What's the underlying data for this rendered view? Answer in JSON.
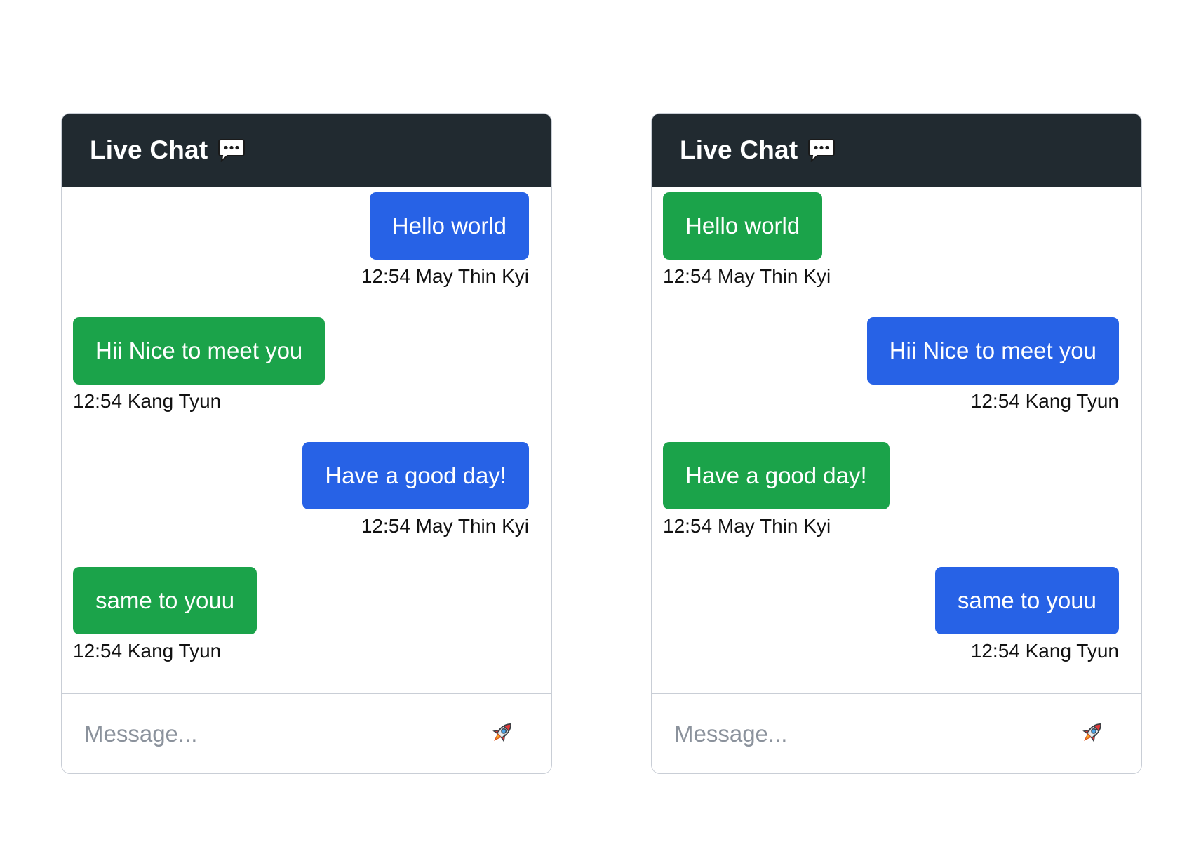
{
  "colors": {
    "header_bg": "#212a30",
    "outgoing_bubble": "#2762e6",
    "incoming_bubble": "#1ba34a",
    "border": "#c9ced6",
    "placeholder": "#8b929c"
  },
  "icons": {
    "header": "chat-bubble-dots-icon",
    "send": "rocket-icon"
  },
  "panels": [
    {
      "title": "Live Chat",
      "messages": [
        {
          "text": "Hello world",
          "meta": "12:54 May Thin Kyi",
          "side": "outgoing",
          "color": "blue"
        },
        {
          "text": "Hii Nice to meet you",
          "meta": "12:54 Kang Tyun",
          "side": "incoming",
          "color": "green"
        },
        {
          "text": "Have a good day!",
          "meta": "12:54 May Thin Kyi",
          "side": "outgoing",
          "color": "blue"
        },
        {
          "text": "same to youu",
          "meta": "12:54 Kang Tyun",
          "side": "incoming",
          "color": "green"
        }
      ],
      "input": {
        "placeholder": "Message...",
        "value": ""
      }
    },
    {
      "title": "Live Chat",
      "messages": [
        {
          "text": "Hello world",
          "meta": "12:54 May Thin Kyi",
          "side": "incoming",
          "color": "green"
        },
        {
          "text": "Hii Nice to meet you",
          "meta": "12:54 Kang Tyun",
          "side": "outgoing",
          "color": "blue"
        },
        {
          "text": "Have a good day!",
          "meta": "12:54 May Thin Kyi",
          "side": "incoming",
          "color": "green"
        },
        {
          "text": "same to youu",
          "meta": "12:54 Kang Tyun",
          "side": "outgoing",
          "color": "blue"
        }
      ],
      "input": {
        "placeholder": "Message...",
        "value": ""
      }
    }
  ]
}
